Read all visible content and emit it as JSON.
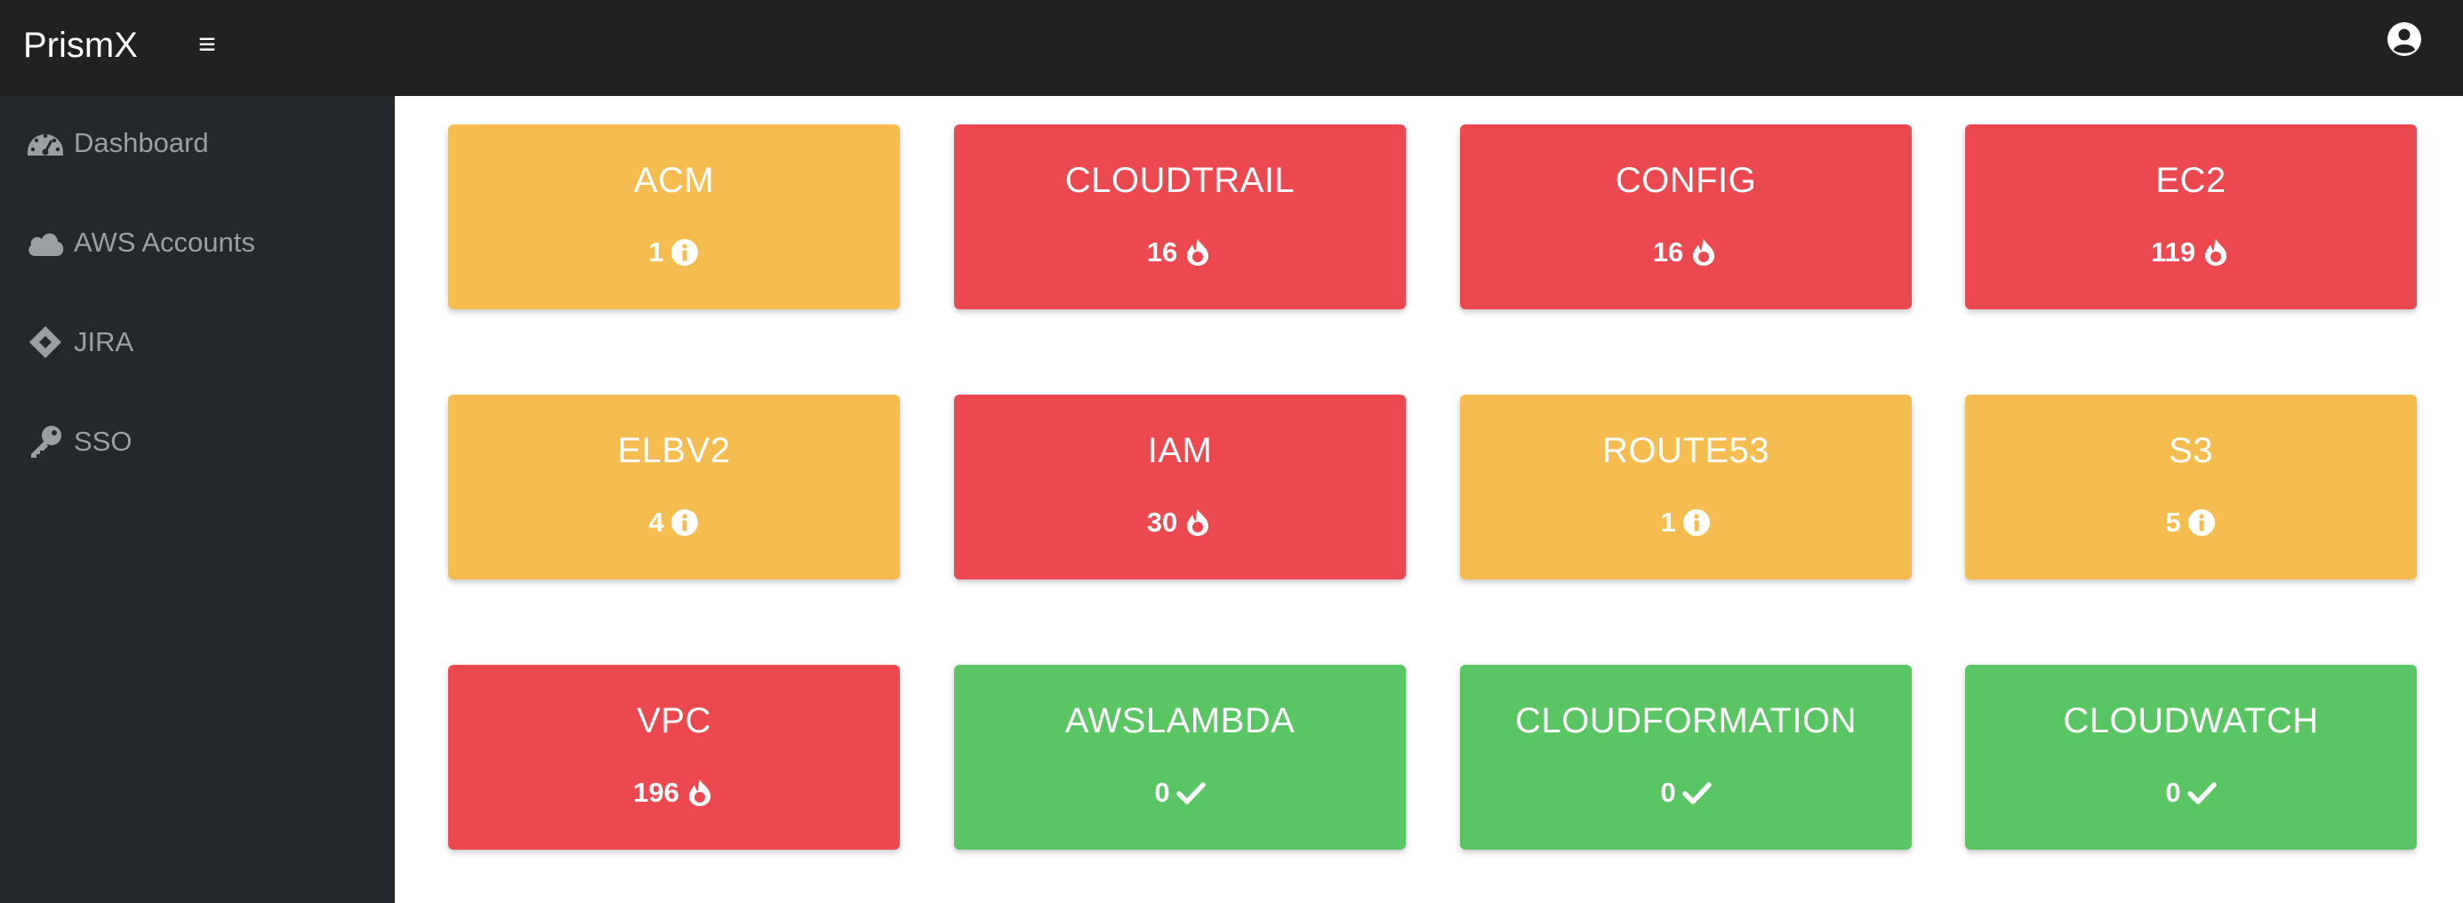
{
  "app": {
    "title": "PrismX"
  },
  "topbar": {
    "menu_icon": "hamburger-icon",
    "user_icon": "user-circle-icon"
  },
  "sidebar": {
    "items": [
      {
        "label": "Dashboard",
        "icon": "gauge-icon"
      },
      {
        "label": "AWS Accounts",
        "icon": "cloud-icon"
      },
      {
        "label": "JIRA",
        "icon": "jira-diamond-icon"
      },
      {
        "label": "SSO",
        "icon": "key-icon"
      }
    ]
  },
  "colors": {
    "warning": "#f5bd4f",
    "danger": "#ec4850",
    "success": "#5ac563",
    "topbar": "#212121",
    "sidebar": "#24272c"
  },
  "cards": [
    {
      "title": "ACM",
      "count": "1",
      "status": "warning",
      "icon": "info-icon"
    },
    {
      "title": "CLOUDTRAIL",
      "count": "16",
      "status": "danger",
      "icon": "fire-icon"
    },
    {
      "title": "CONFIG",
      "count": "16",
      "status": "danger",
      "icon": "fire-icon"
    },
    {
      "title": "EC2",
      "count": "119",
      "status": "danger",
      "icon": "fire-icon"
    },
    {
      "title": "ELBV2",
      "count": "4",
      "status": "warning",
      "icon": "info-icon"
    },
    {
      "title": "IAM",
      "count": "30",
      "status": "danger",
      "icon": "fire-icon"
    },
    {
      "title": "ROUTE53",
      "count": "1",
      "status": "warning",
      "icon": "info-icon"
    },
    {
      "title": "S3",
      "count": "5",
      "status": "warning",
      "icon": "info-icon"
    },
    {
      "title": "VPC",
      "count": "196",
      "status": "danger",
      "icon": "fire-icon"
    },
    {
      "title": "AWSLAMBDA",
      "count": "0",
      "status": "success",
      "icon": "check-icon"
    },
    {
      "title": "CLOUDFORMATION",
      "count": "0",
      "status": "success",
      "icon": "check-icon"
    },
    {
      "title": "CLOUDWATCH",
      "count": "0",
      "status": "success",
      "icon": "check-icon"
    }
  ]
}
